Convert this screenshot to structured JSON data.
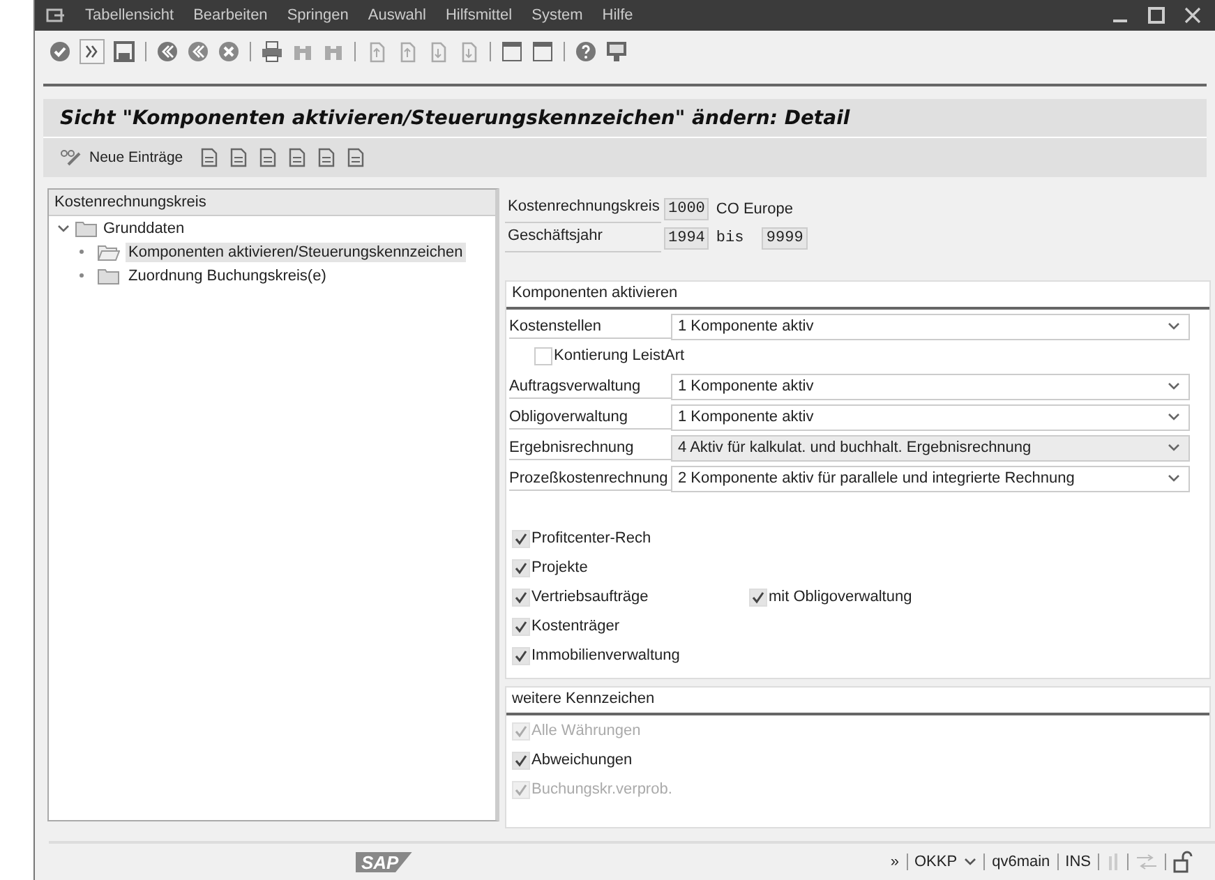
{
  "window": {
    "menu": [
      "Tabellensicht",
      "Bearbeiten",
      "Springen",
      "Auswahl",
      "Hilfsmittel",
      "System",
      "Hilfe"
    ]
  },
  "title": "Sicht \"Komponenten aktivieren/Steuerungskennzeichen\" ändern: Detail",
  "app_toolbar": {
    "new_entries": "Neue Einträge"
  },
  "tree": {
    "header": "Kostenrechnungskreis",
    "items": [
      {
        "label": "Grunddaten",
        "expanded": true,
        "children": [
          {
            "label": "Komponenten aktivieren/Steuerungskennzeichen",
            "selected": true
          },
          {
            "label": "Zuordnung Buchungskreis(e)",
            "selected": false
          }
        ]
      }
    ]
  },
  "header_fields": [
    {
      "label": "Kostenrechnungskreis",
      "value": "1000",
      "text": "CO Europe"
    },
    {
      "label": "Geschäftsjahr",
      "value": "1994",
      "text": "bis",
      "value_to": "9999"
    }
  ],
  "sections": [
    {
      "title": "Komponenten aktivieren",
      "rows": [
        {
          "kind": "dropdown",
          "label": "Kostenstellen",
          "value": "1 Komponente aktiv",
          "focused": false
        },
        {
          "kind": "sub_checkboxes",
          "items": [
            {
              "label": "Kontierung LeistArt",
              "checked": false,
              "disabled": false
            }
          ]
        },
        {
          "kind": "dropdown",
          "label": "Auftragsverwaltung",
          "value": "1 Komponente aktiv",
          "focused": false
        },
        {
          "kind": "dropdown",
          "label": "Obligoverwaltung",
          "value": "1 Komponente aktiv",
          "focused": false
        },
        {
          "kind": "dropdown",
          "label": "Ergebnisrechnung",
          "value": "4 Aktiv für kalkulat. und buchhalt. Ergebnisrechnung",
          "focused": true
        },
        {
          "kind": "dropdown",
          "label": "Prozeßkostenrechnung",
          "value": "2 Komponente aktiv für parallele und integrierte Rechnung",
          "focused": false
        },
        {
          "kind": "spacer"
        },
        {
          "kind": "checkboxes",
          "items": [
            {
              "label": "Profitcenter-Rech",
              "checked": true,
              "disabled": false
            }
          ]
        },
        {
          "kind": "checkboxes",
          "items": [
            {
              "label": "Projekte",
              "checked": true,
              "disabled": false
            }
          ]
        },
        {
          "kind": "checkboxes",
          "items": [
            {
              "label": "Vertriebsaufträge",
              "checked": true,
              "disabled": false
            },
            {
              "label": "mit Obligoverwaltung",
              "checked": true,
              "disabled": false
            }
          ]
        },
        {
          "kind": "checkboxes",
          "items": [
            {
              "label": "Kostenträger",
              "checked": true,
              "disabled": false
            }
          ]
        },
        {
          "kind": "checkboxes",
          "items": [
            {
              "label": "Immobilienverwaltung",
              "checked": true,
              "disabled": false
            }
          ]
        }
      ]
    },
    {
      "title": "weitere Kennzeichen",
      "rows": [
        {
          "kind": "checkboxes",
          "items": [
            {
              "label": "Alle Währungen",
              "checked": true,
              "disabled": true
            }
          ]
        },
        {
          "kind": "checkboxes",
          "items": [
            {
              "label": "Abweichungen",
              "checked": true,
              "disabled": false
            }
          ]
        },
        {
          "kind": "checkboxes",
          "items": [
            {
              "label": "Buchungskr.verprob.",
              "checked": true,
              "disabled": true
            }
          ]
        }
      ]
    }
  ],
  "status_bar": {
    "logo": "SAP",
    "more": "»",
    "transaction": "OKKP",
    "server": "qv6main",
    "mode": "INS"
  }
}
